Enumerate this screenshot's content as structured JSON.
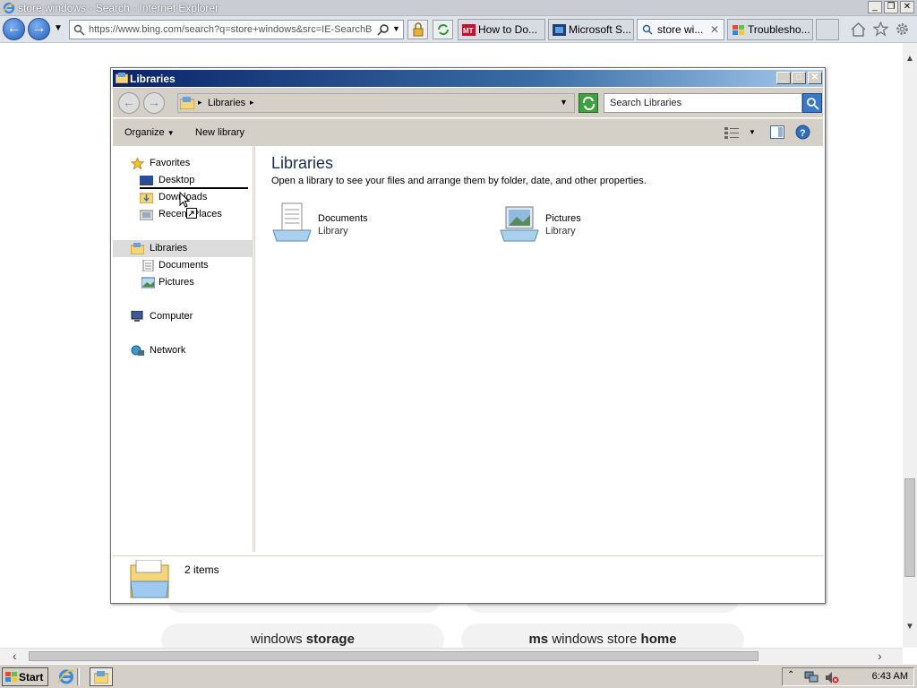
{
  "browser": {
    "title": "store windows - Search - Internet Explorer",
    "address_url": "https://www.bing.com/search?q=store+windows&src=IE-SearchB",
    "tabs": [
      {
        "label": "How to Do...",
        "icon": "mt-logo-icon"
      },
      {
        "label": "Microsoft S...",
        "icon": "microsoft-site-icon"
      },
      {
        "label": "store wi...",
        "icon": "search-icon",
        "active": true
      },
      {
        "label": "Troublesho...",
        "icon": "windows-logo-icon"
      }
    ],
    "page_suggestions": [
      {
        "prefix": "windows ",
        "bold": "storage",
        "suffix": ""
      },
      {
        "prefix": "ms ",
        "plain_middle": "windows store ",
        "bold": "home"
      }
    ]
  },
  "explorer": {
    "title": "Libraries",
    "breadcrumb": "Libraries",
    "search_placeholder": "Search Libraries",
    "toolbar": {
      "organize": "Organize",
      "new_library": "New library"
    },
    "nav": {
      "favorites": "Favorites",
      "desktop": "Desktop",
      "downloads": "Downloads",
      "recent_places": "Recent Places",
      "libraries": "Libraries",
      "documents": "Documents",
      "pictures": "Pictures",
      "computer": "Computer",
      "network": "Network"
    },
    "heading": "Libraries",
    "subtitle": "Open a library to see your files and arrange them by folder, date, and other properties.",
    "libraries": [
      {
        "name": "Documents",
        "type": "Library"
      },
      {
        "name": "Pictures",
        "type": "Library"
      }
    ],
    "status": "2 items"
  },
  "taskbar": {
    "start": "Start",
    "clock": "6:43 AM"
  }
}
